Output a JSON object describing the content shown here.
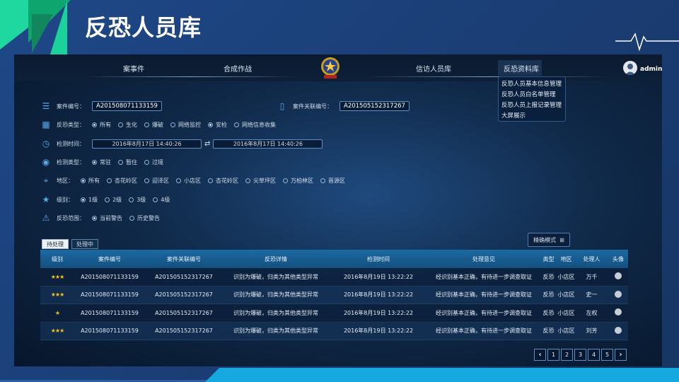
{
  "slide": {
    "title": "反恐人员库"
  },
  "nav": {
    "items": [
      "案事件",
      "合成作战",
      "信访人员库",
      "反恐资料库"
    ],
    "user": "admin"
  },
  "dropdown": [
    "反恐人员基本信息管理",
    "反恐人员白名单管理",
    "反恐人员上报记录管理",
    "大屏展示"
  ],
  "filters": {
    "case_no_label": "案件编号：",
    "case_no_value": "A201508071133159",
    "related_label": "案件关联编号：",
    "related_value": "A201505152317267",
    "type_label": "反恐类型：",
    "type_options": [
      "所有",
      "生化",
      "爆破",
      "网络监控",
      "安检",
      "网络信息收集"
    ],
    "time_label": "检测时间：",
    "time_from": "2016年8月17日 14:40:26",
    "time_to": "2016年8月17日 14:40:26",
    "detect_label": "检测类型：",
    "detect_options": [
      "常驻",
      "暂住",
      "过境"
    ],
    "region_label": "地区：",
    "region_options": [
      "所有",
      "杏花岭区",
      "迎泽区",
      "小店区",
      "杏花岭区",
      "尖草坪区",
      "万柏林区",
      "晋源区"
    ],
    "level_label": "级别：",
    "level_options": [
      "1级",
      "2级",
      "3级",
      "4级"
    ],
    "scope_label": "反恐范围：",
    "scope_options": [
      "当前警告",
      "历史警告"
    ]
  },
  "precise_mode": "精确模式",
  "tabs": [
    "待处理",
    "处理中"
  ],
  "table": {
    "headers": [
      "级别",
      "案件编号",
      "案件关联编号",
      "反恐详情",
      "检测时间",
      "处理意见",
      "类型",
      "地区",
      "处理人",
      "头像"
    ],
    "rows": [
      {
        "stars": "★★★",
        "case": "A201508071133159",
        "related": "A201505152317267",
        "detail": "识别为爆破，归类为其他类型异常",
        "time": "2016年8月19日 13:22:22",
        "opinion": "经识别基本正确，有待进一步调查取证",
        "type": "反恐",
        "region": "小店区",
        "handler": "万千"
      },
      {
        "stars": "★★★",
        "case": "A201508071133159",
        "related": "A201505152317267",
        "detail": "识别为爆破，归类为其他类型异常",
        "time": "2016年8月19日 13:22:22",
        "opinion": "经识别基本正确，有待进一步调查取证",
        "type": "反恐",
        "region": "小店区",
        "handler": "史一"
      },
      {
        "stars": "★",
        "case": "A201508071133159",
        "related": "A201505152317267",
        "detail": "识别为爆破，归类为其他类型异常",
        "time": "2016年8月19日 13:22:22",
        "opinion": "经识别基本正确，有待进一步调查取证",
        "type": "反恐",
        "region": "小店区",
        "handler": "左权"
      },
      {
        "stars": "★★★",
        "case": "A201508071133159",
        "related": "A201505152317267",
        "detail": "识别为爆破，归类为其他类型异常",
        "time": "2016年8月19日 13:22:22",
        "opinion": "经识别基本正确，有待进一步调查取证",
        "type": "反恐",
        "region": "小店区",
        "handler": "刘芳"
      }
    ]
  },
  "pager": {
    "prev": "‹",
    "pages": [
      "1",
      "2",
      "3",
      "4",
      "5"
    ],
    "next": "›"
  },
  "icons": {
    "list": "list-icon",
    "doc": "document-icon",
    "grid": "grid-icon",
    "clock": "clock-icon",
    "pin": "pin-icon",
    "location": "location-icon",
    "star": "star-icon",
    "alert": "alert-icon",
    "swap": "swap-icon"
  },
  "colors": {
    "accent": "#1b6aa2",
    "star": "#f2c21b",
    "green": "#1fd8a0"
  }
}
